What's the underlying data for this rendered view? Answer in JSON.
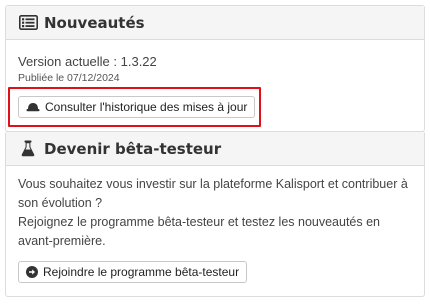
{
  "news": {
    "title": "Nouveautés",
    "icon": "newspaper-icon",
    "version_label": "Version actuelle : 1.3.22",
    "published_label": "Publiée le 07/12/2024",
    "history_button": {
      "label": "Consulter l'historique des mises à jour",
      "icon": "hat-icon"
    }
  },
  "beta": {
    "title": "Devenir bêta-testeur",
    "icon": "flask-icon",
    "paragraph1": "Vous souhaitez vous investir sur la plateforme Kalisport et contribuer à son évolution ?",
    "paragraph2": "Rejoignez le programme bêta-testeur et testez les nouveautés en avant-première.",
    "join_button": {
      "label": "Rejoindre le programme bêta-testeur",
      "icon": "arrow-circle-right-icon"
    }
  },
  "colors": {
    "highlight": "#e0101a",
    "header_bg": "#f5f5f5",
    "border": "#dcdcdc"
  }
}
